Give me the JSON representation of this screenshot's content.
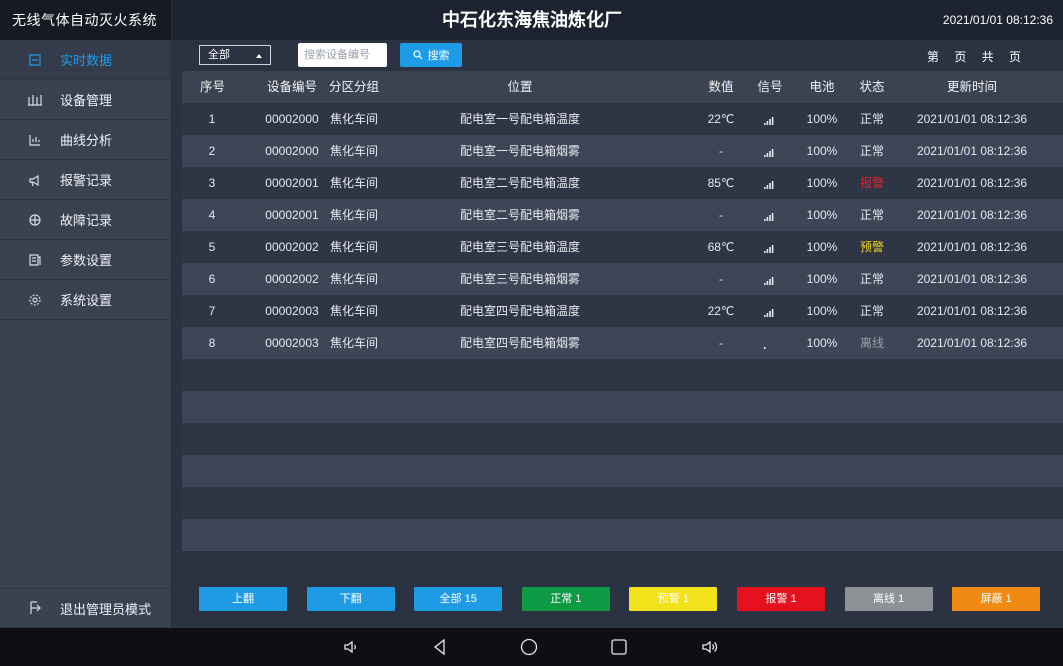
{
  "app": {
    "system_name": "无线气体自动灭火系统",
    "title": "中石化东海焦油炼化厂",
    "datetime": "2021/01/01  08:12:36"
  },
  "sidebar": {
    "items": [
      {
        "label": "实时数据",
        "icon": "realtime-data-icon",
        "active": true
      },
      {
        "label": "设备管理",
        "icon": "device-management-icon",
        "active": false
      },
      {
        "label": "曲线分析",
        "icon": "curve-analysis-icon",
        "active": false
      },
      {
        "label": "报警记录",
        "icon": "alarm-record-icon",
        "active": false
      },
      {
        "label": "故障记录",
        "icon": "fault-record-icon",
        "active": false
      },
      {
        "label": "参数设置",
        "icon": "parameter-settings-icon",
        "active": false
      },
      {
        "label": "系统设置",
        "icon": "system-settings-icon",
        "active": false
      }
    ],
    "exit_label": "退出管理员模式"
  },
  "toolbar": {
    "filter_selected": "全部",
    "search_placeholder": "搜索设备编号",
    "search_label": "搜索",
    "page_info": "第 页 共 页"
  },
  "table": {
    "headers": [
      "序号",
      "设备编号",
      "分区分组",
      "位置",
      "数值",
      "信号",
      "电池",
      "状态",
      "更新时间"
    ],
    "rows": [
      {
        "idx": "1",
        "code": "00002000",
        "zone": "焦化车间",
        "position": "配电室一号配电箱温度",
        "value": "22℃",
        "signal": 4,
        "battery": "100%",
        "status": "正常",
        "time": "2021/01/01  08:12:36"
      },
      {
        "idx": "2",
        "code": "00002000",
        "zone": "焦化车间",
        "position": "配电室一号配电箱烟雾",
        "value": "-",
        "signal": 4,
        "battery": "100%",
        "status": "正常",
        "time": "2021/01/01  08:12:36"
      },
      {
        "idx": "3",
        "code": "00002001",
        "zone": "焦化车间",
        "position": "配电室二号配电箱温度",
        "value": "85℃",
        "signal": 4,
        "battery": "100%",
        "status": "报警",
        "time": "2021/01/01  08:12:36"
      },
      {
        "idx": "4",
        "code": "00002001",
        "zone": "焦化车间",
        "position": "配电室二号配电箱烟雾",
        "value": "-",
        "signal": 4,
        "battery": "100%",
        "status": "正常",
        "time": "2021/01/01  08:12:36"
      },
      {
        "idx": "5",
        "code": "00002002",
        "zone": "焦化车间",
        "position": "配电室三号配电箱温度",
        "value": "68℃",
        "signal": 4,
        "battery": "100%",
        "status": "预警",
        "time": "2021/01/01  08:12:36"
      },
      {
        "idx": "6",
        "code": "00002002",
        "zone": "焦化车间",
        "position": "配电室三号配电箱烟雾",
        "value": "-",
        "signal": 4,
        "battery": "100%",
        "status": "正常",
        "time": "2021/01/01  08:12:36"
      },
      {
        "idx": "7",
        "code": "00002003",
        "zone": "焦化车间",
        "position": "配电室四号配电箱温度",
        "value": "22℃",
        "signal": 4,
        "battery": "100%",
        "status": "正常",
        "time": "2021/01/01  08:12:36"
      },
      {
        "idx": "8",
        "code": "00002003",
        "zone": "焦化车间",
        "position": "配电室四号配电箱烟雾",
        "value": "-",
        "signal": 0,
        "battery": "100%",
        "status": "离线",
        "time": "2021/01/01  08:12:36"
      }
    ],
    "empty_rows": 6
  },
  "status_colors": {
    "正常": "#e6e9ee",
    "报警": "#e5222a",
    "预警": "#f2d21b",
    "离线": "#9aa0a8"
  },
  "filter_bar": {
    "buttons": [
      {
        "label": "上翻",
        "color": "#1f9be6",
        "name": "page-up-button"
      },
      {
        "label": "下翻",
        "color": "#1f9be6",
        "name": "page-down-button"
      },
      {
        "label": "全部 15",
        "color": "#1f9be6",
        "name": "filter-all-button"
      },
      {
        "label": "正常 1",
        "color": "#0f9a45",
        "name": "filter-normal-button"
      },
      {
        "label": "预警 1",
        "color": "#f2e21b",
        "name": "filter-warning-button"
      },
      {
        "label": "报警 1",
        "color": "#e5111f",
        "name": "filter-alarm-button"
      },
      {
        "label": "离线 1",
        "color": "#8e9196",
        "name": "filter-offline-button"
      },
      {
        "label": "屏蔽 1",
        "color": "#f08a12",
        "name": "filter-shielded-button"
      }
    ]
  },
  "navbar": {
    "icons": [
      "volume-down-icon",
      "back-icon",
      "home-icon",
      "recent-apps-icon",
      "volume-up-icon"
    ]
  }
}
